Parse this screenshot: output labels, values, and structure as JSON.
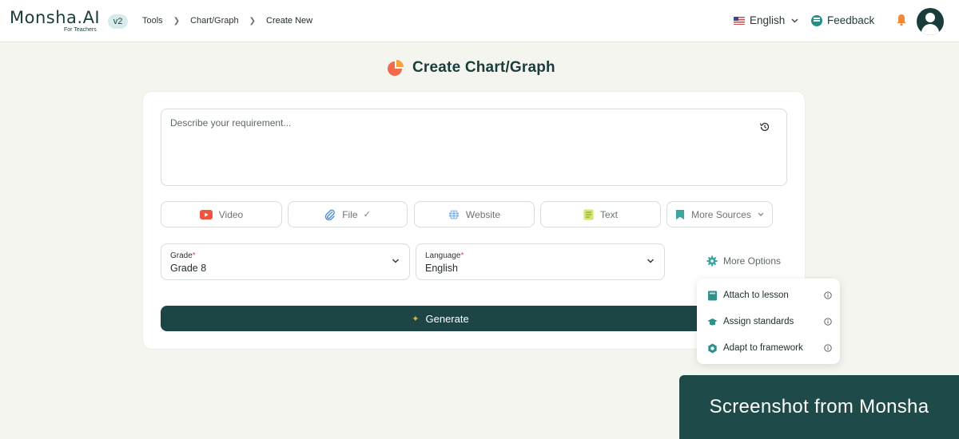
{
  "app": {
    "logo_main": "Monsha.AI",
    "logo_sub": "For Teachers",
    "version": "v2"
  },
  "breadcrumb": [
    "Tools",
    "Chart/Graph",
    "Create New"
  ],
  "header": {
    "language": "English",
    "feedback": "Feedback"
  },
  "page": {
    "title": "Create Chart/Graph"
  },
  "prompt": {
    "placeholder": "Describe your requirement..."
  },
  "sources": {
    "video": "Video",
    "file": "File",
    "file_check": "✓",
    "website": "Website",
    "text": "Text",
    "more": "More Sources"
  },
  "grade": {
    "label": "Grade",
    "value": "Grade 8"
  },
  "language_select": {
    "label": "Language",
    "value": "English"
  },
  "more_options": "More Options",
  "generate": "Generate",
  "menu": {
    "attach": "Attach to lesson",
    "standards": "Assign standards",
    "framework": "Adapt to framework"
  },
  "watermark": "Screenshot from Monsha",
  "colors": {
    "brand_dark": "#1d4545",
    "accent_teal": "#1f8f8a",
    "background": "#f5f5f0",
    "bell_orange": "#f08a3a",
    "required_red": "#e04848"
  },
  "icons": {
    "pie": "pie-chart-icon",
    "history": "history-icon",
    "video": "youtube-icon",
    "file": "paperclip-icon",
    "website": "globe-icon",
    "text": "text-document-icon",
    "more": "bookmark-icon",
    "gear": "gear-icon",
    "bell": "bell-icon"
  }
}
